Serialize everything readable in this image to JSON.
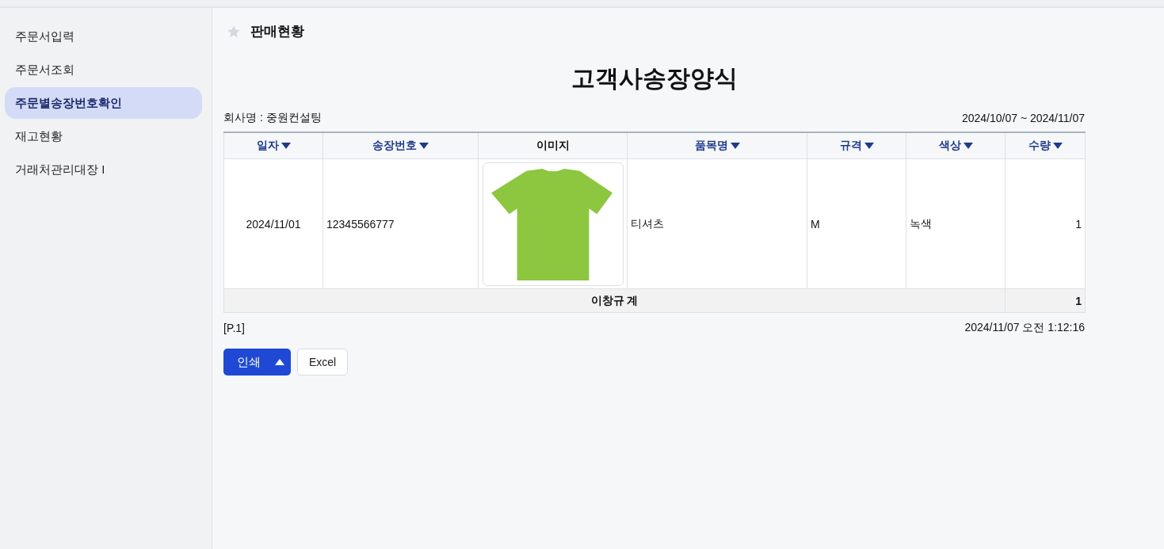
{
  "sidebar": {
    "items": [
      {
        "label": "주문서입력",
        "selected": false
      },
      {
        "label": "주문서조회",
        "selected": false
      },
      {
        "label": "주문별송장번호확인",
        "selected": true
      },
      {
        "label": "재고현황",
        "selected": false
      },
      {
        "label": "거래처관리대장 I",
        "selected": false
      }
    ]
  },
  "page": {
    "title": "판매현황",
    "favorite": false
  },
  "report": {
    "title": "고객사송장양식",
    "company": "회사명 : 중원컨설팅",
    "period": "2024/10/07 ~ 2024/11/07",
    "table": {
      "columns": [
        {
          "label": "일자",
          "sortable": true
        },
        {
          "label": "송장번호",
          "sortable": true
        },
        {
          "label": "이미지",
          "sortable": false
        },
        {
          "label": "품목명",
          "sortable": true
        },
        {
          "label": "규격",
          "sortable": true
        },
        {
          "label": "색상",
          "sortable": true
        },
        {
          "label": "수량",
          "sortable": true
        }
      ],
      "rows": [
        {
          "cells": [
            "2024/11/01",
            "12345566777",
            null,
            "티셔츠",
            "M",
            "녹색",
            "1"
          ]
        }
      ],
      "total": {
        "label": "이창규 계",
        "value": "1"
      }
    },
    "page_number": "[P.1]",
    "printed_at": "2024/11/07 오전 1:12:16"
  },
  "buttons": [
    {
      "kind": "split",
      "label": "인쇄"
    },
    {
      "kind": "plain",
      "label": "Excel"
    }
  ]
}
